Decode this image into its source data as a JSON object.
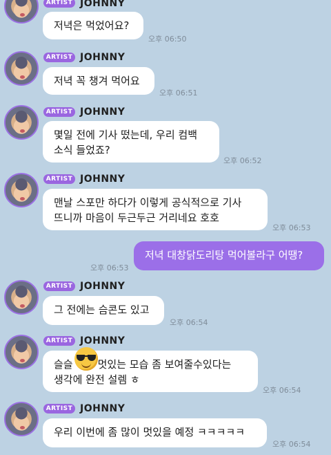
{
  "sender": {
    "badge": "ARTIST",
    "name": "JOHNNY"
  },
  "messages": [
    {
      "text": "저녁은 먹었어요?",
      "time": "오후 06:50"
    },
    {
      "text": "저녁 꼭 챙겨 먹어요",
      "time": "오후 06:51"
    },
    {
      "text": "몇일 전에 기사 떴는데, 우리 컴백\n소식 들었죠?",
      "time": "오후 06:52"
    },
    {
      "text": "맨날 스포만 하다가 이렇게 공식적으로 기사\n뜨니까 마음이 두근두근 거리네요 호호",
      "time": "오후 06:53"
    },
    {
      "text": "저녁 대창닭도리탕 먹어볼라구 어땡?",
      "time": "오후 06:53"
    },
    {
      "text": "그 전에는 슴콘도 있고",
      "time": "오후 06:54"
    },
    {
      "text_line1_before": "슬슬",
      "text_line1_after": "멋있는 모습 좀 보여줄수있다는",
      "text_line2": "생각에 완전 설렘 ㅎ",
      "emoji": "sunglasses-emoji",
      "time": "오후 06:54"
    },
    {
      "text": "우리 이번에 좀 많이 멋있을 예정 ㅋㅋㅋㅋㅋ",
      "time": "오후 06:54"
    }
  ],
  "colors": {
    "background": "#bdd2e3",
    "accent": "#9a66e0",
    "outgoing": "#9b6fe8",
    "incoming": "#ffffff"
  }
}
